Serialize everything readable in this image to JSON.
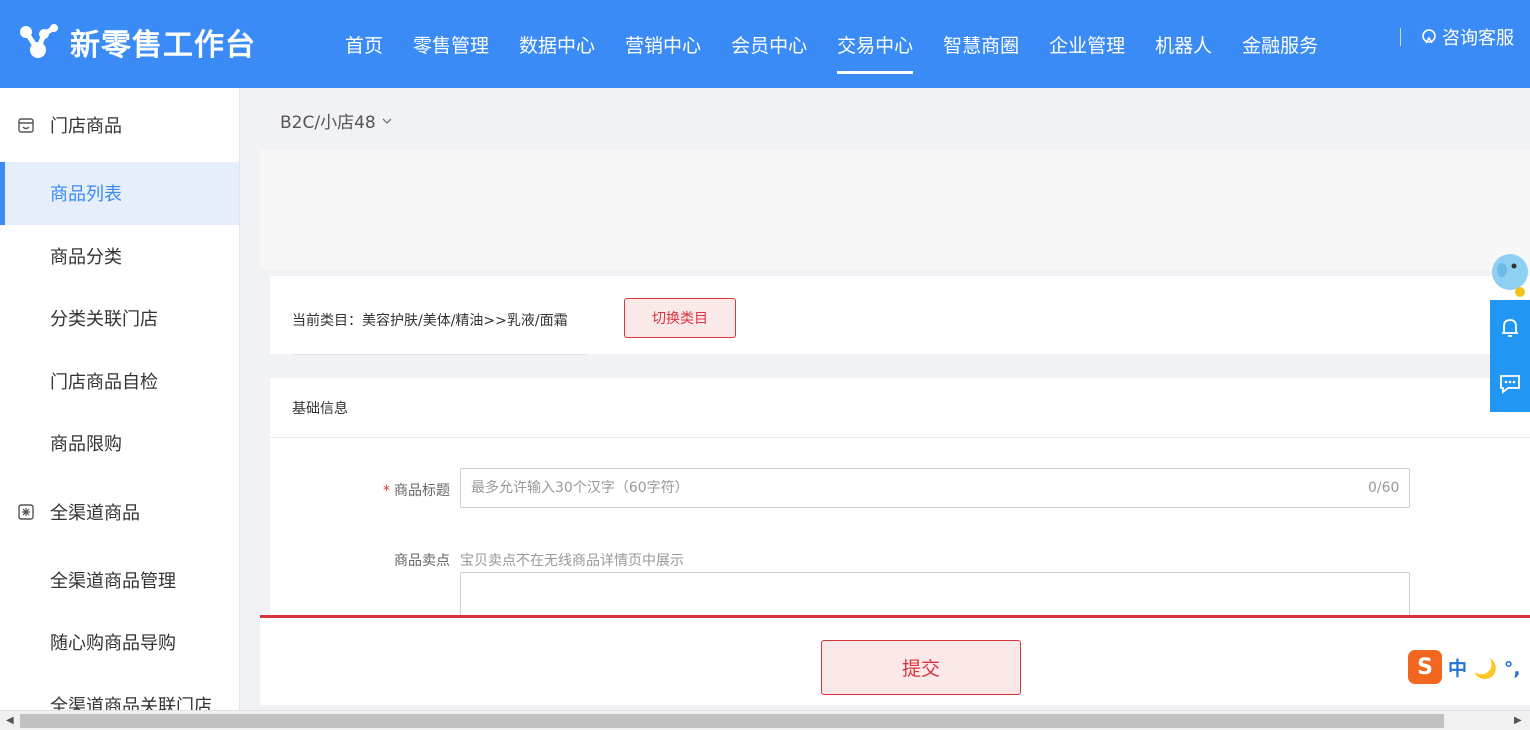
{
  "header": {
    "logo_text": "新零售工作台",
    "nav": [
      {
        "label": "首页"
      },
      {
        "label": "零售管理"
      },
      {
        "label": "数据中心"
      },
      {
        "label": "营销中心"
      },
      {
        "label": "会员中心"
      },
      {
        "label": "交易中心",
        "active": true
      },
      {
        "label": "智慧商圈"
      },
      {
        "label": "企业管理"
      },
      {
        "label": "机器人"
      },
      {
        "label": "金融服务"
      }
    ],
    "support_label": "咨询客服"
  },
  "sidebar": {
    "groups": [
      {
        "label": "门店商品",
        "icon": "store-icon",
        "items": [
          "商品列表",
          "商品分类",
          "分类关联门店",
          "门店商品自检",
          "商品限购"
        ]
      },
      {
        "label": "全渠道商品",
        "icon": "omni-channel-icon",
        "items": [
          "全渠道商品管理",
          "随心购商品导购",
          "全渠道商品关联门店"
        ]
      }
    ],
    "active_item": "商品列表"
  },
  "store": {
    "name": "B2C/小店48"
  },
  "category": {
    "label": "当前类目：美容护肤/美体/精油>>乳液/面霜",
    "switch_label": "切换类目"
  },
  "basic_info": {
    "title": "基础信息",
    "product_title": {
      "label": "商品标题",
      "placeholder": "最多允许输入30个汉字（60字符）",
      "counter": "0/60"
    },
    "selling_point": {
      "label": "商品卖点",
      "hint": "宝贝卖点不在无线商品详情页中展示"
    }
  },
  "footer": {
    "submit_label": "提交"
  },
  "ime": {
    "logo": "S",
    "text": "中 🌙 °,"
  },
  "colors": {
    "primary": "#3a8bf5",
    "danger": "#d9343d",
    "float": "#2196f3"
  }
}
